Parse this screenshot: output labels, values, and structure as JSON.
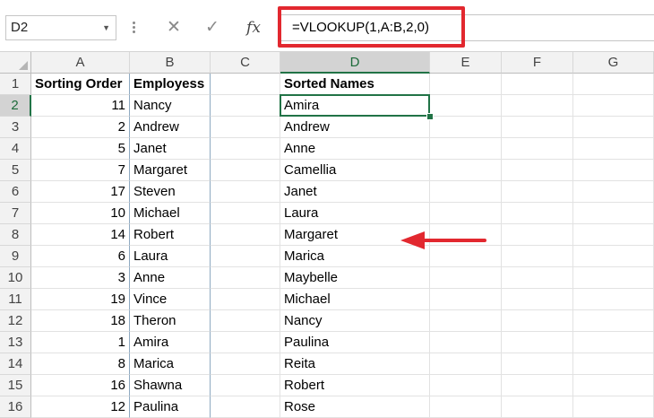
{
  "formula_bar": {
    "name_box": "D2",
    "formula": "=VLOOKUP(1,A:B,2,0)",
    "fx_label": "fx",
    "cancel_symbol": "✕",
    "enter_symbol": "✓"
  },
  "columns": [
    "A",
    "B",
    "C",
    "D",
    "E",
    "F",
    "G"
  ],
  "rows": [
    "1",
    "2",
    "3",
    "4",
    "5",
    "6",
    "7",
    "8",
    "9",
    "10",
    "11",
    "12",
    "13",
    "14",
    "15",
    "16"
  ],
  "header_row": {
    "a": "Sorting Order",
    "b": "Employess",
    "c": "",
    "d": "Sorted Names"
  },
  "table": [
    {
      "a": "11",
      "b": "Nancy",
      "d": "Amira"
    },
    {
      "a": "2",
      "b": "Andrew",
      "d": "Andrew"
    },
    {
      "a": "5",
      "b": "Janet",
      "d": "Anne"
    },
    {
      "a": "7",
      "b": "Margaret",
      "d": "Camellia"
    },
    {
      "a": "17",
      "b": "Steven",
      "d": "Janet"
    },
    {
      "a": "10",
      "b": "Michael",
      "d": "Laura"
    },
    {
      "a": "14",
      "b": "Robert",
      "d": "Margaret"
    },
    {
      "a": "6",
      "b": "Laura",
      "d": "Marica"
    },
    {
      "a": "3",
      "b": "Anne",
      "d": "Maybelle"
    },
    {
      "a": "19",
      "b": "Vince",
      "d": "Michael"
    },
    {
      "a": "18",
      "b": "Theron",
      "d": "Nancy"
    },
    {
      "a": "1",
      "b": "Amira",
      "d": "Paulina"
    },
    {
      "a": "8",
      "b": "Marica",
      "d": "Reita"
    },
    {
      "a": "16",
      "b": "Shawna",
      "d": "Robert"
    },
    {
      "a": "12",
      "b": "Paulina",
      "d": "Rose"
    }
  ],
  "active_cell": "D2",
  "colors": {
    "highlight": "#e2282f",
    "selection": "#217346",
    "arrow": "#e2282f"
  }
}
